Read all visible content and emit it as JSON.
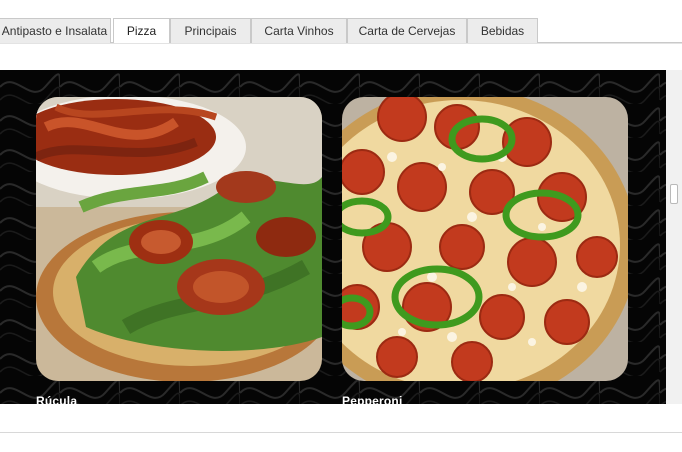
{
  "tabs": [
    {
      "label": "Antipasto e Insalata",
      "active": false
    },
    {
      "label": "Pizza",
      "active": true
    },
    {
      "label": "Principais",
      "active": false
    },
    {
      "label": "Carta Vinhos",
      "active": false
    },
    {
      "label": "Carta de Cervejas",
      "active": false
    },
    {
      "label": "Bebidas",
      "active": false
    }
  ],
  "gallery": {
    "items": [
      {
        "caption": "Rúcula",
        "image": "pizza-rucula-photo"
      },
      {
        "caption": "Pepperoni",
        "image": "pizza-pepperoni-photo"
      }
    ]
  },
  "colors": {
    "gallery_background": "#050505",
    "tab_background": "#ececec",
    "tab_active_background": "#ffffff",
    "tab_border": "#c9c9c9"
  }
}
